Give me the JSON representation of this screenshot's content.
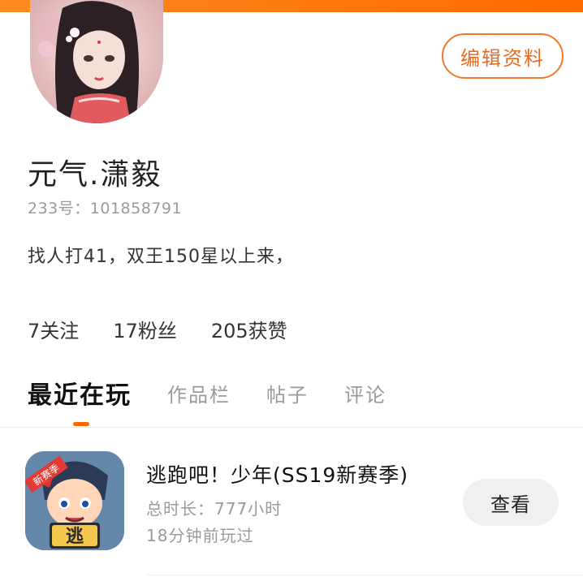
{
  "profile": {
    "nickname": "元气.潇毅",
    "uid": "233号：101858791",
    "bio": "找人打41，双王150星以上来，",
    "edit_label": "编辑资料"
  },
  "stats": [
    {
      "label": "7关注"
    },
    {
      "label": "17粉丝"
    },
    {
      "label": "205获赞"
    }
  ],
  "tabs": [
    {
      "label": "最近在玩",
      "active": true
    },
    {
      "label": "作品栏"
    },
    {
      "label": "帖子"
    },
    {
      "label": "评论"
    }
  ],
  "recent_game": {
    "title": "逃跑吧！少年(SS19新赛季)",
    "duration": "总时长：777小时",
    "last_played": "18分钟前玩过",
    "view_label": "查看",
    "icon_badge": "新赛季",
    "icon_char": "逃"
  },
  "colors": {
    "accent": "#ff6a00",
    "edit_border": "#f07a2c"
  }
}
